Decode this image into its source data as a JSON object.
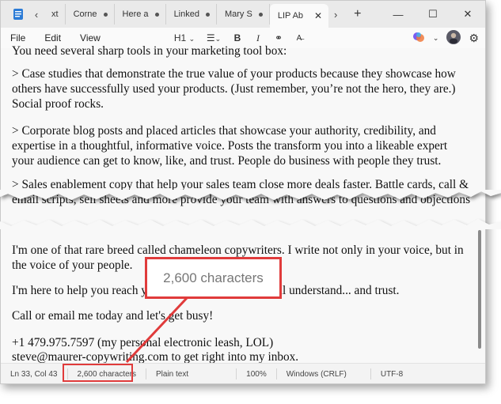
{
  "tabs": [
    {
      "label": "xt"
    },
    {
      "label": "Corne"
    },
    {
      "label": "Here a"
    },
    {
      "label": "Linked"
    },
    {
      "label": "Mary S"
    },
    {
      "label": "LIP Ab",
      "active": true
    }
  ],
  "menu": {
    "file": "File",
    "edit": "Edit",
    "view": "View",
    "heading": "H1"
  },
  "document": {
    "p0": "You need several sharp tools in your marketing tool box:",
    "p1": "> Case studies that demonstrate the true value of your products because they showcase how others have successfully used your products. (Just remember, you’re not the hero, they are.) Social proof rocks.",
    "p2": "> Corporate blog posts and placed articles that showcase your authority, credibility, and expertise in a thoughtful, informative voice. Posts the transform you into a likeable expert your audience can get to know, like, and trust. People do business with people they trust.",
    "p3": "> Sales enablement copy that help your sales team close more deals faster. Battle cards, call & email scripts, sell sheets and more provide your team with answers to questions and objections",
    "p4": "I'm one of that rare breed called chameleon copywriters. I write not only in your voice, but in the voice of your people.",
    "p5a": "I'm here to help you reach yo",
    "p5b": "ey'll understand... and trust.",
    "p6": "Call or email me today and let's get busy!",
    "p7": "+1 479.975.7597 (my personal electronic leash, LOL)",
    "p8": "steve@maurer-copywriting.com to get right into my inbox."
  },
  "status": {
    "position": "Ln 33, Col 43",
    "characters": "2,600 characters",
    "format": "Plain text",
    "zoom": "100%",
    "line_ending": "Windows (CRLF)",
    "encoding": "UTF-8"
  },
  "callout": {
    "text": "2,600 characters",
    "color": "#e03b3b"
  }
}
